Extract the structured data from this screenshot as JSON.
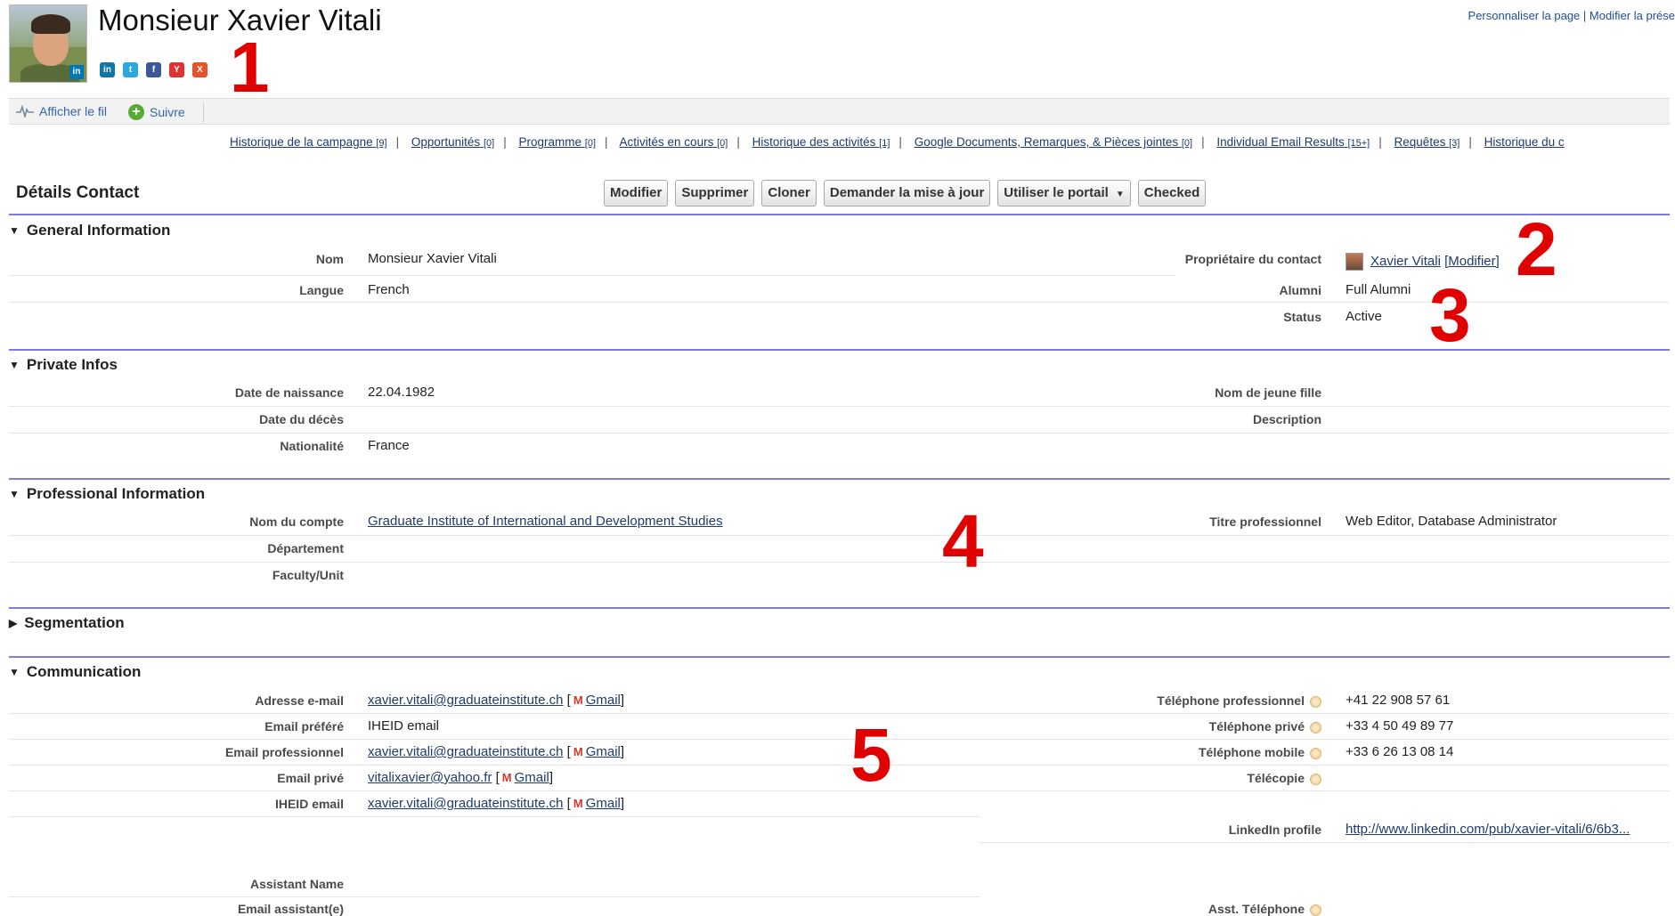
{
  "header": {
    "title": "Monsieur Xavier Vitali",
    "top_links": [
      "Personnaliser la page",
      "Modifier la prése"
    ],
    "social_icons": [
      "linkedin-icon",
      "twitter-icon",
      "facebook-icon",
      "youtube-icon",
      "xing-icon"
    ]
  },
  "annotations": [
    "1",
    "2",
    "3",
    "4",
    "5"
  ],
  "feed": {
    "show_feed": "Afficher le fil",
    "follow": "Suivre"
  },
  "related_links": [
    {
      "label": "Historique de la campagne",
      "count": "[9]"
    },
    {
      "label": "Opportunités",
      "count": "[0]"
    },
    {
      "label": "Programme",
      "count": "[0]"
    },
    {
      "label": "Activités en cours",
      "count": "[0]"
    },
    {
      "label": "Historique des activités",
      "count": "[1]"
    },
    {
      "label": "Google Documents, Remarques, & Pièces jointes",
      "count": "[0]"
    },
    {
      "label": "Individual Email Results",
      "count": "[15+]"
    },
    {
      "label": "Requêtes",
      "count": "[3]"
    },
    {
      "label": "Historique du c",
      "count": ""
    }
  ],
  "detail": {
    "title": "Détails Contact",
    "buttons": [
      "Modifier",
      "Supprimer",
      "Cloner",
      "Demander la mise à jour",
      "Utiliser le portail",
      "Checked"
    ]
  },
  "general": {
    "heading": "General Information",
    "nom_label": "Nom",
    "nom_value": "Monsieur Xavier Vitali",
    "owner_label": "Propriétaire du contact",
    "owner_value": "Xavier Vitali",
    "owner_modify": "[Modifier]",
    "langue_label": "Langue",
    "langue_value": "French",
    "alumni_label": "Alumni",
    "alumni_value": "Full Alumni",
    "status_label": "Status",
    "status_value": "Active"
  },
  "private": {
    "heading": "Private Infos",
    "dob_label": "Date de naissance",
    "dob_value": "22.04.1982",
    "maiden_label": "Nom de jeune fille",
    "death_label": "Date du décès",
    "desc_label": "Description",
    "nat_label": "Nationalité",
    "nat_value": "France"
  },
  "professional": {
    "heading": "Professional Information",
    "account_label": "Nom du compte",
    "account_value": "Graduate Institute of International and Development Studies",
    "jobtitle_label": "Titre professionnel",
    "jobtitle_value": "Web Editor, Database Administrator",
    "dept_label": "Département",
    "faculty_label": "Faculty/Unit"
  },
  "segmentation": {
    "heading": "Segmentation"
  },
  "communication": {
    "heading": "Communication",
    "gmail_label": "Gmail",
    "email_label": "Adresse e-mail",
    "email_value": "xavier.vitali@graduateinstitute.ch",
    "pref_label": "Email préféré",
    "pref_value": "IHEID email",
    "proemail_label": "Email professionnel",
    "proemail_value": "xavier.vitali@graduateinstitute.ch",
    "privemail_label": "Email privé",
    "privemail_value": "vitalixavier@yahoo.fr",
    "iheid_label": "IHEID email",
    "iheid_value": "xavier.vitali@graduateinstitute.ch",
    "prophone_label": "Téléphone professionnel",
    "prophone_value": "+41 22 908 57 61",
    "privphone_label": "Téléphone privé",
    "privphone_value": "+33 4 50 49 89 77",
    "mobile_label": "Téléphone mobile",
    "mobile_value": "+33 6 26 13 08 14",
    "fax_label": "Télécopie",
    "linkedin_label": "LinkedIn profile",
    "linkedin_value": "http://www.linkedin.com/pub/xavier-vitali/6/6b3...",
    "asst_name_label": "Assistant Name",
    "asst_email_label": "Email assistant(e)",
    "asst_phone_label": "Asst. Téléphone"
  }
}
